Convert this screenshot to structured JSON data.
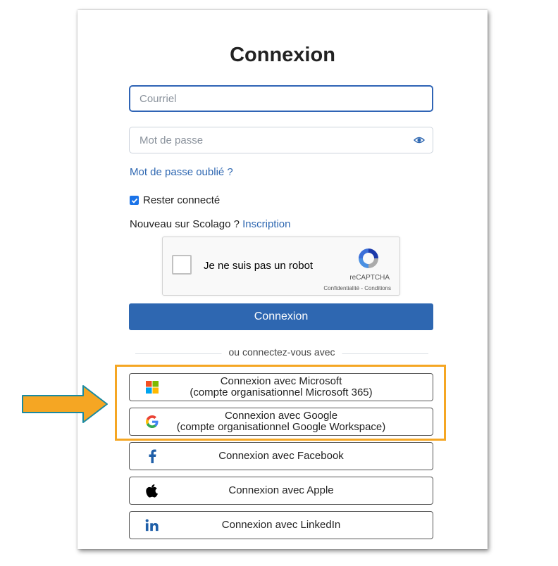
{
  "colors": {
    "accent": "#2e67b1",
    "highlight": "#f5a623",
    "arrow": "#f5a623",
    "arrow_border": "#1a8aa0"
  },
  "title": "Connexion",
  "form": {
    "email_placeholder": "Courriel",
    "password_placeholder": "Mot de passe",
    "forgot_label": "Mot de passe oublié ?",
    "remember_label": "Rester connecté",
    "remember_checked": true,
    "new_text": "Nouveau sur Scolago ? ",
    "signup_link": "Inscription"
  },
  "captcha": {
    "label": "Je ne suis pas un robot",
    "brand": "reCAPTCHA",
    "terms": "Confidentialité - Conditions"
  },
  "submit_label": "Connexion",
  "divider_text": "ou connectez-vous avec",
  "social": [
    {
      "line1": "Connexion avec Microsoft",
      "line2": "(compte organisationnel Microsoft 365)",
      "icon": "microsoft-icon"
    },
    {
      "line1": "Connexion avec Google",
      "line2": "(compte organisationnel Google Workspace)",
      "icon": "google-icon"
    },
    {
      "line1": "Connexion avec Facebook",
      "icon": "facebook-icon"
    },
    {
      "line1": "Connexion avec Apple",
      "icon": "apple-icon"
    },
    {
      "line1": "Connexion avec LinkedIn",
      "icon": "linkedin-icon"
    }
  ]
}
